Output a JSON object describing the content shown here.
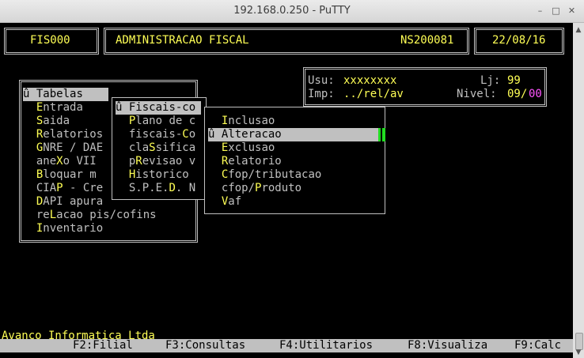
{
  "window": {
    "title": "192.168.0.250 - PuTTY",
    "minimize_glyph": "–",
    "maximize_glyph": "□",
    "close_glyph": "✕"
  },
  "header": {
    "code": "FIS000",
    "system": "ADMINISTRACAO FISCAL",
    "terminal_id": "NS200081",
    "date": "22/08/16"
  },
  "user_info": {
    "usu_label": "Usu:",
    "usu_value": "xxxxxxxx",
    "lj_label": "Lj:",
    "lj_value": "99",
    "imp_label": "Imp:",
    "imp_value": "../rel/av",
    "nivel_label": "Nivel:",
    "nivel_value_a": "09/",
    "nivel_value_b": "00"
  },
  "menu1": {
    "items": [
      {
        "pre": "û ",
        "hot": "T",
        "rest": "abelas"
      },
      {
        "pre": "  ",
        "hot": "E",
        "rest": "ntrada"
      },
      {
        "pre": "  ",
        "hot": "S",
        "rest": "aida"
      },
      {
        "pre": "  ",
        "hot": "R",
        "rest": "elatorios"
      },
      {
        "pre": "  ",
        "hot": "G",
        "rest": "NRE / DAE"
      },
      {
        "pre": "  ",
        "before": "ane",
        "hot": "X",
        "rest": "o VII"
      },
      {
        "pre": "  ",
        "hot": "B",
        "rest": "loquar m"
      },
      {
        "pre": "  ",
        "before": "CIA",
        "hot": "P",
        "rest": " - Cre"
      },
      {
        "pre": "  ",
        "hot": "D",
        "rest": "API apura"
      },
      {
        "pre": "  ",
        "before": "re",
        "hot": "L",
        "rest": "acao pis/cofins"
      },
      {
        "pre": "  ",
        "hot": "I",
        "rest": "nventario"
      }
    ]
  },
  "menu2": {
    "items": [
      {
        "pre": "û ",
        "hot": "F",
        "rest": "iscais-co"
      },
      {
        "pre": "  ",
        "hot": "P",
        "rest": "lano de c"
      },
      {
        "pre": "  ",
        "before": "fiscais-",
        "hot": "C",
        "rest": "o"
      },
      {
        "pre": "  ",
        "before": "cla",
        "hot": "S",
        "rest": "sifica"
      },
      {
        "pre": "  ",
        "before": "p",
        "hot": "R",
        "rest": "evisao v"
      },
      {
        "pre": "  ",
        "hot": "H",
        "rest": "istorico"
      },
      {
        "pre": "  ",
        "before": "S.P.E.",
        "hot": "D",
        "rest": ". N"
      }
    ]
  },
  "menu3": {
    "items": [
      {
        "pre": "  ",
        "hot": "I",
        "rest": "nclusao"
      },
      {
        "pre": "û ",
        "hot": "A",
        "rest": "lteracao"
      },
      {
        "pre": "  ",
        "hot": "E",
        "rest": "xclusao"
      },
      {
        "pre": "  ",
        "hot": "R",
        "rest": "elatorio"
      },
      {
        "pre": "  ",
        "hot": "C",
        "rest": "fop/tributacao"
      },
      {
        "pre": "  ",
        "before": "cfop/",
        "hot": "P",
        "rest": "roduto"
      },
      {
        "pre": "  ",
        "hot": "V",
        "rest": "af"
      }
    ]
  },
  "function_keys": [
    "F2:Filial",
    "F3:Consultas",
    "F4:Utilitarios",
    "F8:Visualiza",
    "F9:Calc"
  ],
  "footer": {
    "company": "Avanco Informatica Ltda"
  },
  "scrollbar": {
    "up_glyph": "▲",
    "down_glyph": "▼"
  }
}
